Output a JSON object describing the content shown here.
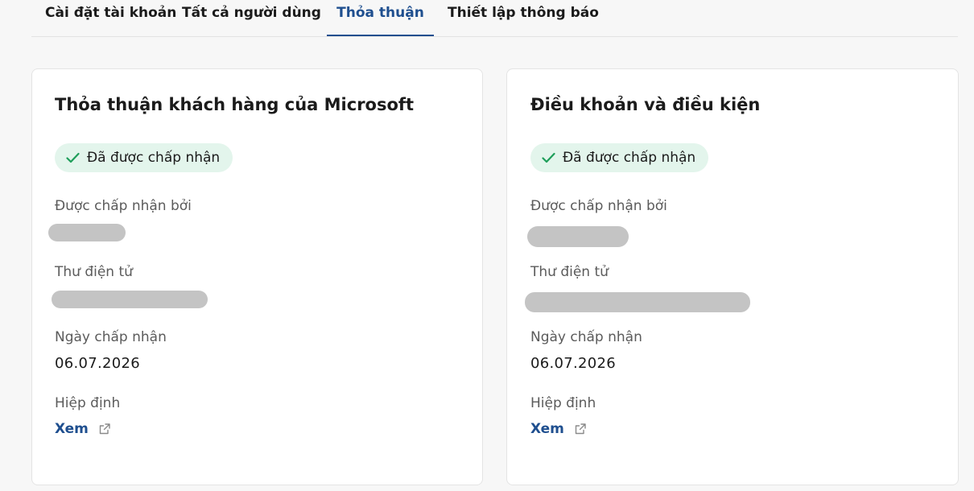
{
  "tabs": [
    {
      "label": "Cài đặt tài khoản",
      "active": false
    },
    {
      "label": "Tất cả người dùng",
      "active": false
    },
    {
      "label": "Thỏa thuận",
      "active": true
    },
    {
      "label": "Thiết lập thông báo",
      "active": false
    }
  ],
  "colors": {
    "accent": "#1f4f8f",
    "badge_bg": "#e3f5ec",
    "check": "#1e9e5a",
    "redacted": "#c4c4c4"
  },
  "cards": [
    {
      "title": "Thỏa thuận khách hàng của Microsoft",
      "status": "Đã được chấp nhận",
      "status_icon": "checkmark-icon",
      "accepted_by_label": "Được chấp nhận bởi",
      "email_label": "Thư điện tử",
      "date_label": "Ngày chấp nhận",
      "date_value": "06.07.2026",
      "agreement_label": "Hiệp định",
      "view_link": "Xem",
      "link_icon": "external-link-icon"
    },
    {
      "title": "Điều khoản và điều kiện",
      "status": "Đã được chấp nhận",
      "status_icon": "checkmark-icon",
      "accepted_by_label": "Được chấp nhận bởi",
      "email_label": "Thư điện tử",
      "date_label": "Ngày chấp nhận",
      "date_value": "06.07.2026",
      "agreement_label": "Hiệp định",
      "view_link": "Xem",
      "link_icon": "external-link-icon"
    }
  ]
}
